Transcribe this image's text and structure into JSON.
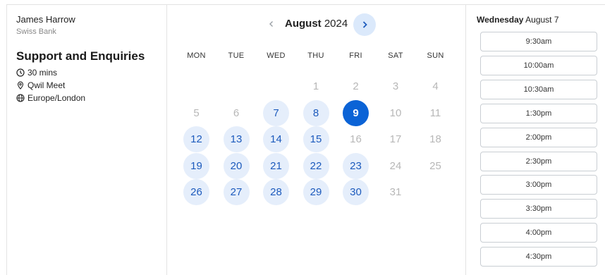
{
  "host": {
    "name": "James Harrow",
    "company": "Swiss Bank"
  },
  "event": {
    "title": "Support and Enquiries",
    "duration": "30 mins",
    "location": "Qwil Meet",
    "timezone": "Europe/London"
  },
  "calendar": {
    "month": "August",
    "year": "2024",
    "weekdays": [
      "MON",
      "TUE",
      "WED",
      "THU",
      "FRI",
      "SAT",
      "SUN"
    ],
    "days": [
      {
        "d": "1",
        "c": 3,
        "r": 0,
        "s": "off"
      },
      {
        "d": "2",
        "c": 4,
        "r": 0,
        "s": "off"
      },
      {
        "d": "3",
        "c": 5,
        "r": 0,
        "s": "off"
      },
      {
        "d": "4",
        "c": 6,
        "r": 0,
        "s": "off"
      },
      {
        "d": "5",
        "c": 0,
        "r": 1,
        "s": "off"
      },
      {
        "d": "6",
        "c": 1,
        "r": 1,
        "s": "off"
      },
      {
        "d": "7",
        "c": 2,
        "r": 1,
        "s": "avail"
      },
      {
        "d": "8",
        "c": 3,
        "r": 1,
        "s": "avail"
      },
      {
        "d": "9",
        "c": 4,
        "r": 1,
        "s": "selected"
      },
      {
        "d": "10",
        "c": 5,
        "r": 1,
        "s": "off"
      },
      {
        "d": "11",
        "c": 6,
        "r": 1,
        "s": "off"
      },
      {
        "d": "12",
        "c": 0,
        "r": 2,
        "s": "avail"
      },
      {
        "d": "13",
        "c": 1,
        "r": 2,
        "s": "avail"
      },
      {
        "d": "14",
        "c": 2,
        "r": 2,
        "s": "avail"
      },
      {
        "d": "15",
        "c": 3,
        "r": 2,
        "s": "avail"
      },
      {
        "d": "16",
        "c": 4,
        "r": 2,
        "s": "off"
      },
      {
        "d": "17",
        "c": 5,
        "r": 2,
        "s": "off"
      },
      {
        "d": "18",
        "c": 6,
        "r": 2,
        "s": "off"
      },
      {
        "d": "19",
        "c": 0,
        "r": 3,
        "s": "avail"
      },
      {
        "d": "20",
        "c": 1,
        "r": 3,
        "s": "avail"
      },
      {
        "d": "21",
        "c": 2,
        "r": 3,
        "s": "avail"
      },
      {
        "d": "22",
        "c": 3,
        "r": 3,
        "s": "avail"
      },
      {
        "d": "23",
        "c": 4,
        "r": 3,
        "s": "avail"
      },
      {
        "d": "24",
        "c": 5,
        "r": 3,
        "s": "off"
      },
      {
        "d": "25",
        "c": 6,
        "r": 3,
        "s": "off"
      },
      {
        "d": "26",
        "c": 0,
        "r": 4,
        "s": "avail"
      },
      {
        "d": "27",
        "c": 1,
        "r": 4,
        "s": "avail"
      },
      {
        "d": "28",
        "c": 2,
        "r": 4,
        "s": "avail"
      },
      {
        "d": "29",
        "c": 3,
        "r": 4,
        "s": "avail"
      },
      {
        "d": "30",
        "c": 4,
        "r": 4,
        "s": "avail"
      },
      {
        "d": "31",
        "c": 5,
        "r": 4,
        "s": "off"
      }
    ]
  },
  "times": {
    "weekday": "Wednesday",
    "date": "August 7",
    "slots": [
      "9:30am",
      "10:00am",
      "10:30am",
      "1:30pm",
      "2:00pm",
      "2:30pm",
      "3:00pm",
      "3:30pm",
      "4:00pm",
      "4:30pm"
    ]
  },
  "colors": {
    "accent": "#0b63d6",
    "available_bg": "#e5eefb",
    "available_text": "#1d5bbd",
    "disabled_text": "#b7b7b7"
  }
}
